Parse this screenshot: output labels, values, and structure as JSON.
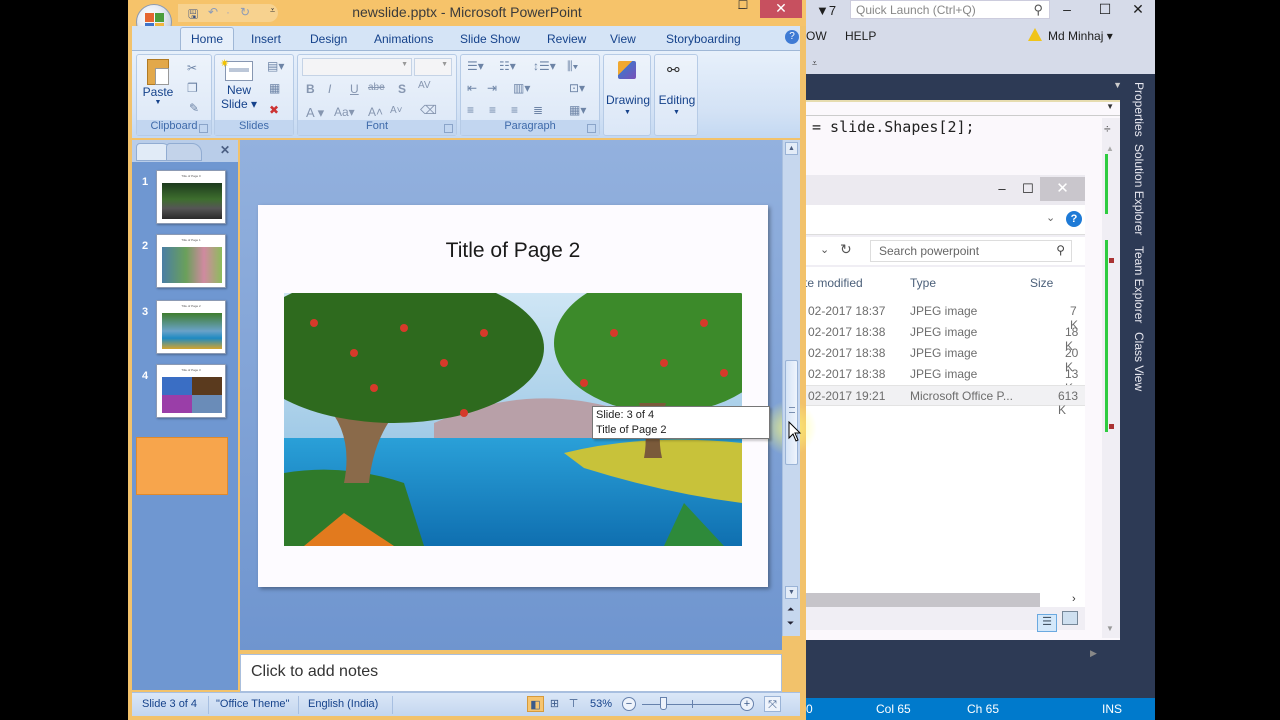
{
  "visual_studio": {
    "notification_count": "7",
    "quick_launch_placeholder": "Quick Launch (Ctrl+Q)",
    "menu": [
      "OW",
      "HELP"
    ],
    "user_name": "Md Minhaj",
    "code_line": "= slide.Shapes[2];",
    "side_tabs": [
      "Properties",
      "Solution Explorer",
      "Team Explorer",
      "Class View"
    ],
    "status": {
      "line_fragment": "0",
      "col": "Col 65",
      "ch": "Ch 65",
      "mode": "INS"
    }
  },
  "file_explorer": {
    "search_placeholder": "Search powerpoint",
    "columns": [
      "te modified",
      "Type",
      "Size"
    ],
    "rows": [
      {
        "modified": "02-2017 18:37",
        "type": "JPEG image",
        "size": "7 K"
      },
      {
        "modified": "02-2017 18:38",
        "type": "JPEG image",
        "size": "18 K"
      },
      {
        "modified": "02-2017 18:38",
        "type": "JPEG image",
        "size": "20 K"
      },
      {
        "modified": "02-2017 18:38",
        "type": "JPEG image",
        "size": "13 K"
      },
      {
        "modified": "02-2017 19:21",
        "type": "Microsoft Office P...",
        "size": "613 K",
        "selected": true
      }
    ]
  },
  "powerpoint": {
    "window_title": "newslide.pptx - Microsoft PowerPoint",
    "tabs": [
      "Home",
      "Insert",
      "Design",
      "Animations",
      "Slide Show",
      "Review",
      "View",
      "Storyboarding"
    ],
    "active_tab": "Home",
    "ribbon": {
      "clipboard": {
        "label": "Clipboard",
        "paste": "Paste"
      },
      "slides": {
        "label": "Slides",
        "new_slide_line1": "New",
        "new_slide_line2": "Slide ▾"
      },
      "font": {
        "label": "Font",
        "font_name": "",
        "font_size": ""
      },
      "paragraph": {
        "label": "Paragraph"
      },
      "drawing": {
        "label": "Drawing"
      },
      "editing": {
        "label": "Editing"
      }
    },
    "slides": [
      {
        "number": "1",
        "title": "Title of Page 0"
      },
      {
        "number": "2",
        "title": "Title of Page 1"
      },
      {
        "number": "3",
        "title": "Title of Page 2",
        "selected": true
      },
      {
        "number": "4",
        "title": "Title of Page 3"
      }
    ],
    "current_slide": {
      "title": "Title of Page 2"
    },
    "tooltip": {
      "line1": "Slide: 3 of 4",
      "line2": "Title of Page 2"
    },
    "notes_placeholder": "Click to add notes",
    "status": {
      "slide_info": "Slide 3 of 4",
      "theme": "\"Office Theme\"",
      "language": "English (India)",
      "zoom": "53%",
      "zoom_percent": 53
    }
  }
}
